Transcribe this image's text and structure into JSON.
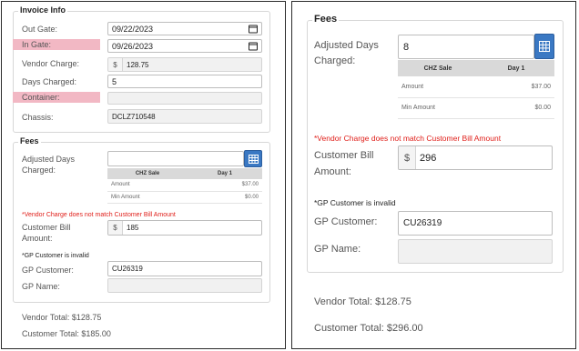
{
  "left": {
    "invoice": {
      "legend": "Invoice Info",
      "out_gate_label": "Out Gate:",
      "out_gate_value": "09/22/2023",
      "in_gate_label": "In Gate:",
      "in_gate_value": "09/26/2023",
      "vendor_charge_label": "Vendor Charge:",
      "vendor_charge_currency": "$",
      "vendor_charge_value": "128.75",
      "days_charged_label": "Days Charged:",
      "days_charged_value": "5",
      "container_label": "Container:",
      "container_value": "",
      "chassis_label": "Chassis:",
      "chassis_value": "DCLZ710548"
    },
    "fees": {
      "legend": "Fees",
      "adjusted_days_label_1": "Adjusted Days",
      "adjusted_days_label_2": "Charged:",
      "adjusted_days_value": "",
      "table_header_col1": "CHZ Sale",
      "table_header_col2": "Day 1",
      "rows": [
        {
          "label": "Amount",
          "value": "$37.00"
        },
        {
          "label": "Min Amount",
          "value": "$0.00"
        }
      ],
      "vendor_mismatch_error": "*Vendor Charge does not match Customer Bill Amount",
      "customer_bill_label_1": "Customer Bill",
      "customer_bill_label_2": "Amount:",
      "customer_bill_currency": "$",
      "customer_bill_value": "185",
      "gp_invalid_note": "*GP Customer is invalid",
      "gp_customer_label": "GP Customer:",
      "gp_customer_value": "CU26319",
      "gp_name_label": "GP Name:",
      "gp_name_value": ""
    },
    "vendor_total": "Vendor Total: $128.75",
    "customer_total": "Customer Total: $185.00"
  },
  "right": {
    "fees": {
      "legend": "Fees",
      "adjusted_days_label_1": "Adjusted Days",
      "adjusted_days_label_2": "Charged:",
      "adjusted_days_value": "8",
      "table_header_col1": "CHZ Sale",
      "table_header_col2": "Day 1",
      "rows": [
        {
          "label": "Amount",
          "value": "$37.00"
        },
        {
          "label": "Min Amount",
          "value": "$0.00"
        }
      ],
      "vendor_mismatch_error": "*Vendor Charge does not match Customer Bill Amount",
      "customer_bill_label_1": "Customer Bill",
      "customer_bill_label_2": "Amount:",
      "customer_bill_currency": "$",
      "customer_bill_value": "296",
      "gp_invalid_note": "*GP Customer is invalid",
      "gp_customer_label": "GP Customer:",
      "gp_customer_value": "CU26319",
      "gp_name_label": "GP Name:",
      "gp_name_value": ""
    },
    "vendor_total": "Vendor Total: $128.75",
    "customer_total": "Customer Total: $296.00"
  },
  "colors": {
    "required_label_bg": "#f2b8c4",
    "error_text": "#e0201b",
    "accent_button": "#3a78c3"
  },
  "icons": [
    "calendar-icon",
    "grid-calculator-icon"
  ]
}
